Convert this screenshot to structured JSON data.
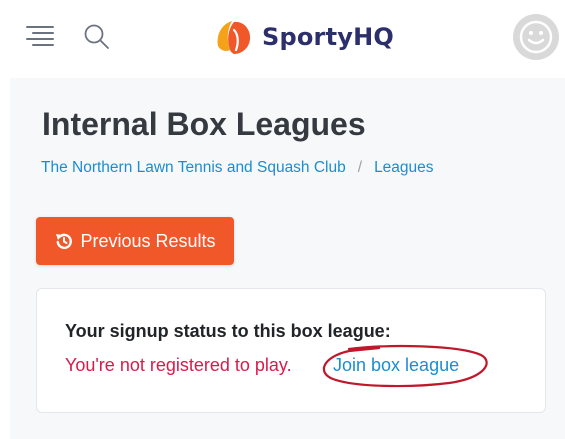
{
  "header": {
    "brand": "SportyHQ",
    "icons": {
      "menu": "hamburger-menu-icon",
      "search": "search-icon",
      "logo": "sportyhq-logo-icon",
      "avatar": "smiley-avatar-icon"
    }
  },
  "page": {
    "title": "Internal Box Leagues",
    "breadcrumb": {
      "club": "The Northern Lawn Tennis and Squash Club",
      "separator": "/",
      "current": "Leagues"
    },
    "previous_results_button": "Previous Results"
  },
  "signup": {
    "heading": "Your signup status to this box league:",
    "status": "You're not registered to play.",
    "join_link": "Join box league"
  },
  "colors": {
    "accent_orange": "#f0582a",
    "link_blue": "#1a8ed1",
    "status_red": "#d81b4a",
    "annotation_red": "#c0182b",
    "brand_navy": "#2b2f6b"
  }
}
